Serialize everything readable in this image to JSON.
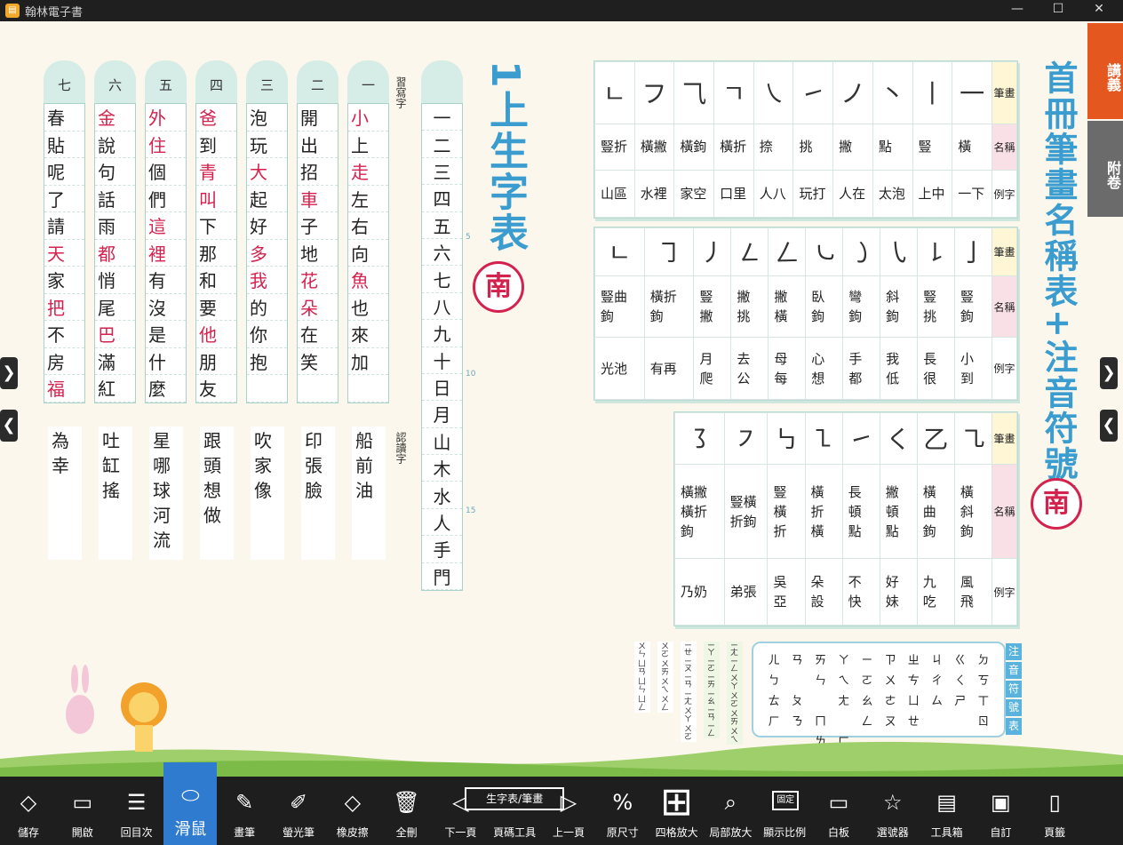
{
  "window": {
    "title": "翰林電子書",
    "min": "—",
    "max": "☐",
    "close": "✕"
  },
  "side_tabs": [
    {
      "label": "講義",
      "color": "#e4571f"
    },
    {
      "label": "附卷",
      "color": "#6b6b6b"
    }
  ],
  "left_page": {
    "title": "1上生字表",
    "publisher_badge": "南",
    "write_label": "習寫字",
    "read_label": "認讀字",
    "columns": [
      {
        "head": "七",
        "chars": [
          "春",
          "貼",
          "呢",
          "了",
          "請",
          "天",
          "家",
          "把",
          "不",
          "房",
          "福"
        ],
        "red": [
          5,
          7,
          10
        ]
      },
      {
        "head": "六",
        "chars": [
          "金",
          "說",
          "句",
          "話",
          "雨",
          "都",
          "悄",
          "尾",
          "巴",
          "滿",
          "紅"
        ],
        "red": [
          0,
          5,
          8
        ]
      },
      {
        "head": "五",
        "chars": [
          "外",
          "住",
          "個",
          "們",
          "這",
          "裡",
          "有",
          "沒",
          "是",
          "什",
          "麼"
        ],
        "red": [
          0,
          1,
          4,
          5
        ]
      },
      {
        "head": "四",
        "chars": [
          "爸",
          "到",
          "青",
          "叫",
          "下",
          "那",
          "和",
          "要",
          "他",
          "朋",
          "友"
        ],
        "red": [
          0,
          2,
          3,
          8
        ]
      },
      {
        "head": "三",
        "chars": [
          "泡",
          "玩",
          "大",
          "起",
          "好",
          "多",
          "我",
          "的",
          "你",
          "抱",
          ""
        ],
        "red": [
          2,
          5,
          6
        ]
      },
      {
        "head": "二",
        "chars": [
          "開",
          "出",
          "招",
          "車",
          "子",
          "地",
          "花",
          "朵",
          "在",
          "笑",
          ""
        ],
        "red": [
          3,
          6,
          7
        ]
      },
      {
        "head": "一",
        "chars": [
          "小",
          "上",
          "走",
          "左",
          "右",
          "向",
          "魚",
          "也",
          "來",
          "加",
          ""
        ],
        "red": [
          0,
          2,
          6
        ]
      }
    ],
    "read_columns": [
      [
        "為",
        "幸"
      ],
      [
        "吐",
        "缸",
        "搖"
      ],
      [
        "星",
        "哪",
        "球",
        "河",
        "流"
      ],
      [
        "跟",
        "頭",
        "想",
        "做"
      ],
      [
        "吹",
        "家",
        "像"
      ],
      [
        "印",
        "張",
        "臉"
      ],
      [
        "船",
        "前",
        "油"
      ]
    ],
    "number_column": [
      "一",
      "二",
      "三",
      "四",
      "五",
      "六",
      "七",
      "八",
      "九",
      "十",
      "日",
      "月",
      "山",
      "木",
      "水",
      "人",
      "手",
      "門"
    ],
    "line_numbers": [
      "5",
      "10",
      "15"
    ]
  },
  "right_page": {
    "title": "首冊筆畫名稱表+注音符號表",
    "publisher_badge": "南",
    "row_labels": {
      "stroke": "筆畫",
      "name": "名稱",
      "example": "例字"
    },
    "table1": {
      "strokes": [
        "ㄴ",
        "フ",
        "⺄",
        "ㄱ",
        "㇏",
        "㇀",
        "ノ",
        "丶",
        "丨",
        "一"
      ],
      "names": [
        "豎折",
        "橫撇",
        "橫鉤",
        "橫折",
        "捺",
        "挑",
        "撇",
        "點",
        "豎",
        "橫"
      ],
      "examples": [
        "山區",
        "水裡",
        "家空",
        "口里",
        "人八",
        "玩打",
        "人在",
        "太泡",
        "上中",
        "一下"
      ]
    },
    "table2": {
      "strokes": [
        "ㄴ",
        "㇆",
        "㇓",
        "㇜",
        "ㄥ",
        "㇃",
        "㇁",
        "㇂",
        "㇙",
        "亅"
      ],
      "names": [
        "豎曲鉤",
        "橫折鉤",
        "豎撇",
        "撇挑",
        "撇橫",
        "臥鉤",
        "彎鉤",
        "斜鉤",
        "豎挑",
        "豎鉤"
      ],
      "examples": [
        "光池",
        "有再",
        "月爬",
        "去公",
        "母每",
        "心想",
        "手都",
        "我低",
        "長很",
        "小到"
      ]
    },
    "table3": {
      "strokes": [
        "㇌",
        "㇇",
        "㇉",
        "㇅",
        "㇀",
        "く",
        "乙",
        "㇈"
      ],
      "names": [
        "橫撇橫折鉤",
        "豎橫折鉤",
        "豎橫折",
        "橫折橫",
        "長頓點",
        "撇頓點",
        "橫曲鉤",
        "橫斜鉤"
      ],
      "examples": [
        "乃奶",
        "弟張",
        "吳亞",
        "朵設",
        "不快",
        "好妹",
        "九吃",
        "風飛"
      ]
    },
    "zhuyin_label": "注音符號表",
    "zhuyin": [
      "ㄦ",
      "ㄢ",
      "ㄞ",
      "ㄚ",
      "ㄧ",
      "ㄗ",
      "ㄓ",
      "ㄐ",
      "ㄍ",
      "ㄉ",
      "ㄅ",
      "",
      "ㄣ",
      "ㄟ",
      "ㄛ",
      "ㄨ",
      "ㄘ",
      "ㄔ",
      "ㄑ",
      "ㄎ",
      "ㄊ",
      "ㄆ",
      "",
      "ㄤ",
      "ㄠ",
      "ㄜ",
      "ㄩ",
      "ㄙ",
      "ㄕ",
      "ㄒ",
      "ㄏ",
      "ㄋ",
      "ㄇ",
      "",
      "ㄥ",
      "ㄡ",
      "ㄝ",
      "",
      "",
      "ㄖ",
      "",
      "",
      "ㄌ",
      "ㄈ"
    ],
    "combo_cols": [
      [
        "ㄨㄣ",
        "ㄩㄢ",
        "ㄩㄣ",
        "ㄩㄥ"
      ],
      [
        "ㄨㄛ",
        "ㄨㄞ",
        "ㄨㄟ",
        "ㄨㄥ"
      ],
      [
        "ㄧㄝ",
        "ㄧㄡ",
        "ㄧㄢ",
        "ㄧㄤ",
        "ㄨㄚ",
        "ㄨㄛ"
      ],
      [
        "ㄧㄚ",
        "ㄧㄛ",
        "ㄧㄞ",
        "ㄧㄠ",
        "ㄧㄢ",
        "ㄧㄥ"
      ],
      [
        "ㄧㄤ",
        "ㄧㄥ",
        "ㄨㄚ",
        "ㄨㄛ",
        "ㄨㄞ",
        "ㄨㄟ"
      ]
    ]
  },
  "toolbar": [
    {
      "label": "儲存",
      "icon": "◇",
      "name": "save"
    },
    {
      "label": "開啟",
      "icon": "▭",
      "name": "open"
    },
    {
      "label": "回目次",
      "icon": "☰",
      "name": "toc"
    },
    {
      "label": "滑鼠",
      "icon": "⬭",
      "name": "mouse",
      "active": true
    },
    {
      "label": "畫筆",
      "icon": "✎",
      "name": "pen"
    },
    {
      "label": "螢光筆",
      "icon": "✐",
      "name": "highlighter"
    },
    {
      "label": "橡皮擦",
      "icon": "◇",
      "name": "eraser"
    },
    {
      "label": "全刪",
      "icon": "🗑",
      "name": "delete-all"
    },
    {
      "label": "下一頁",
      "icon": "◁",
      "name": "next-page"
    },
    {
      "label": "頁碼工具",
      "icon": "生字表/筆畫",
      "name": "page-tool"
    },
    {
      "label": "上一頁",
      "icon": "▷",
      "name": "prev-page"
    },
    {
      "label": "原尺寸",
      "icon": "%",
      "name": "original-size"
    },
    {
      "label": "四格放大",
      "icon": "⊞",
      "name": "quad-zoom"
    },
    {
      "label": "局部放大",
      "icon": "⌕",
      "name": "zoom-part"
    },
    {
      "label": "顯示比例",
      "icon": "固定",
      "name": "display-ratio"
    },
    {
      "label": "白板",
      "icon": "▭",
      "name": "whiteboard"
    },
    {
      "label": "選號器",
      "icon": "☆",
      "name": "picker"
    },
    {
      "label": "工具箱",
      "icon": "▤",
      "name": "toolbox"
    },
    {
      "label": "自訂",
      "icon": "▣",
      "name": "custom"
    },
    {
      "label": "頁籤",
      "icon": "▯",
      "name": "bookmark"
    }
  ]
}
